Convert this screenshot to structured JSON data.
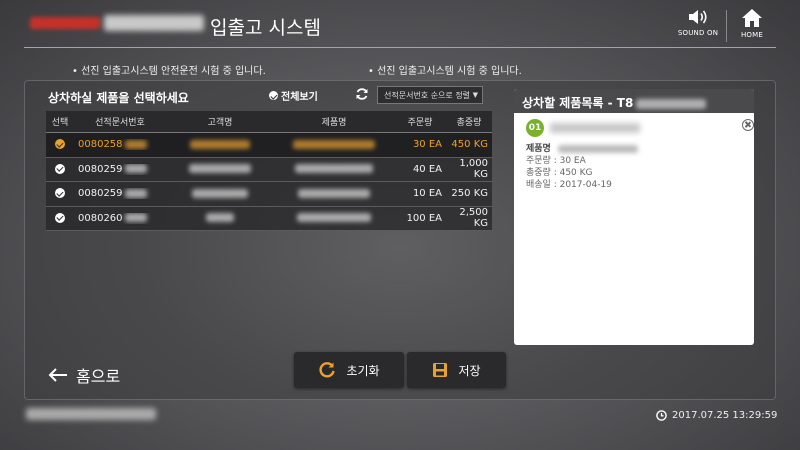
{
  "header": {
    "title": "입출고 시스템",
    "sound_label": "SOUND ON",
    "home_label": "HOME"
  },
  "notices": [
    "• 선진 입출고시스템 안전운전 시험 중 입니다.",
    "• 선진 입출고시스템 시험 중 입니다."
  ],
  "table_section": {
    "title": "상차하실 제품을 선택하세요",
    "view_all": "전체보기",
    "sort_value": "선적문서번호 순으로 정렬",
    "columns": [
      "선택",
      "선적문서번호",
      "고객명",
      "제품명",
      "주문량",
      "총중량"
    ],
    "rows": [
      {
        "doc": "0080258",
        "qty": "30 EA",
        "weight": "450 KG",
        "selected": true
      },
      {
        "doc": "0080259",
        "qty": "40 EA",
        "weight": "1,000 KG",
        "selected": false
      },
      {
        "doc": "0080259",
        "qty": "10 EA",
        "weight": "250 KG",
        "selected": false
      },
      {
        "doc": "0080260",
        "qty": "100 EA",
        "weight": "2,500 KG",
        "selected": false
      }
    ]
  },
  "card": {
    "title": "상차할 제품목록 - T8",
    "item_number": "01",
    "product_label": "제품명",
    "order_qty": "주문량 : 30 EA",
    "total_weight": "총중량 : 450 KG",
    "ship_date": "배송일 : 2017-04-19"
  },
  "bottom": {
    "home_link": "홈으로",
    "reset_label": "초기화",
    "save_label": "저장"
  },
  "footer": {
    "datetime": "2017.07.25 13:29:59"
  },
  "colors": {
    "accent": "#e9a230",
    "divider": "#d6a329",
    "badge": "#79b12c"
  }
}
